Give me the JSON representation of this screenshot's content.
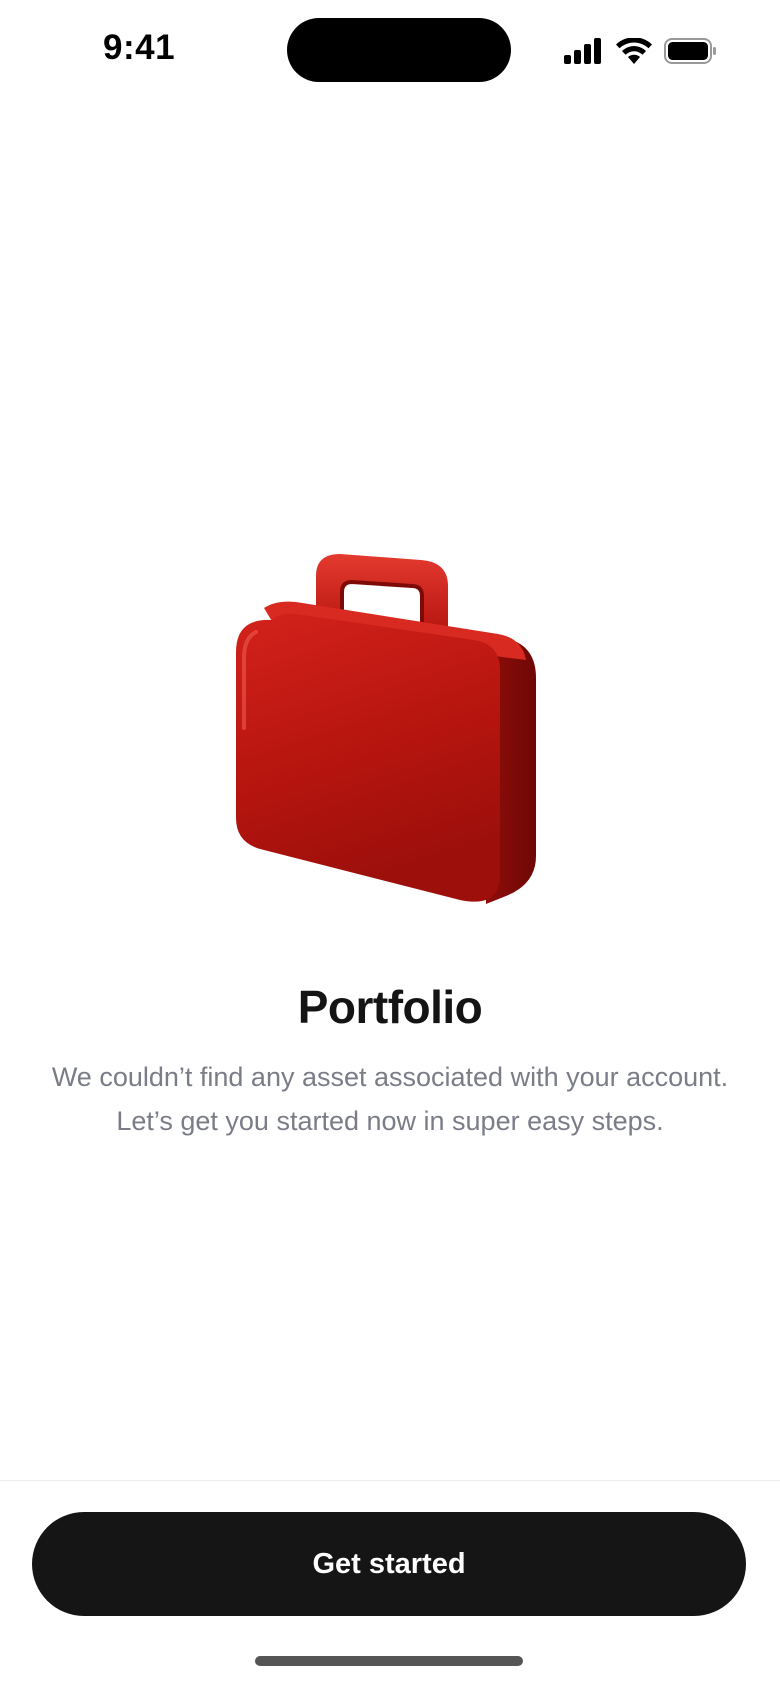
{
  "status_bar": {
    "time": "9:41",
    "icons": [
      "cellular-signal-icon",
      "wifi-icon",
      "battery-icon"
    ]
  },
  "illustration": {
    "icon": "briefcase-icon",
    "color": "#c41a16"
  },
  "empty_state": {
    "title": "Portfolio",
    "message_line1": "We couldn’t find any asset associated with your account.",
    "message_line2": "Let’s get you started now in super easy steps."
  },
  "footer": {
    "cta_label": "Get started"
  },
  "colors": {
    "background": "#ffffff",
    "primary_button": "#151515",
    "subtitle_text": "#7a7d88"
  }
}
